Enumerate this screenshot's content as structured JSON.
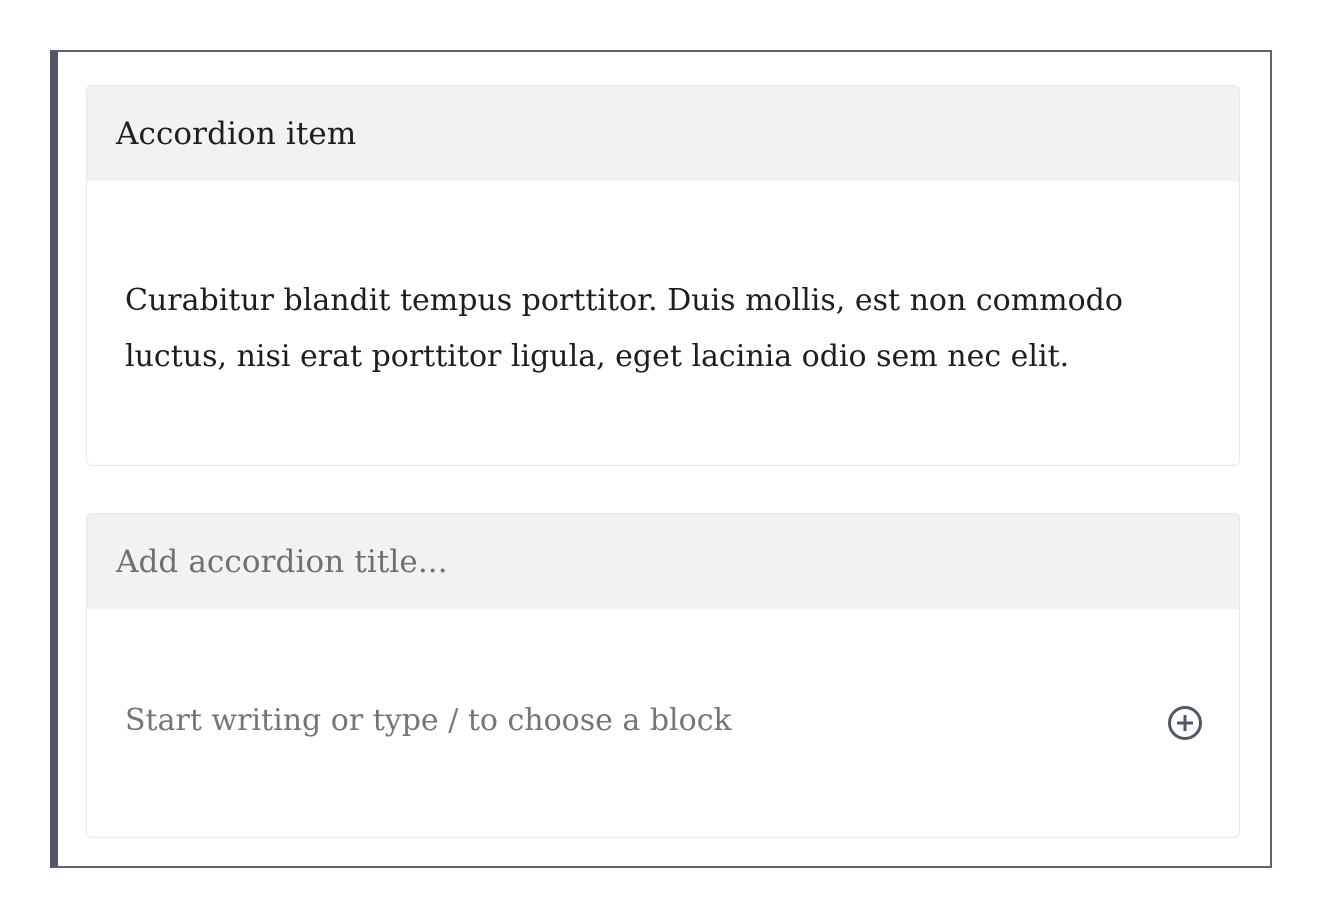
{
  "accordion": {
    "items": [
      {
        "title": "Accordion item",
        "content": "Curabitur blandit tempus porttitor. Duis mollis, est non commodo luctus, nisi erat porttitor ligula, eget lacinia odio sem nec elit."
      },
      {
        "title_placeholder": "Add accordion title...",
        "content_placeholder": "Start writing or type / to choose a block"
      }
    ],
    "add_block_icon": "plus-circle-icon"
  },
  "colors": {
    "border": "#5b6570",
    "header_bg": "#f2f2f2",
    "text": "#1e1e1e",
    "placeholder": "#757575"
  }
}
